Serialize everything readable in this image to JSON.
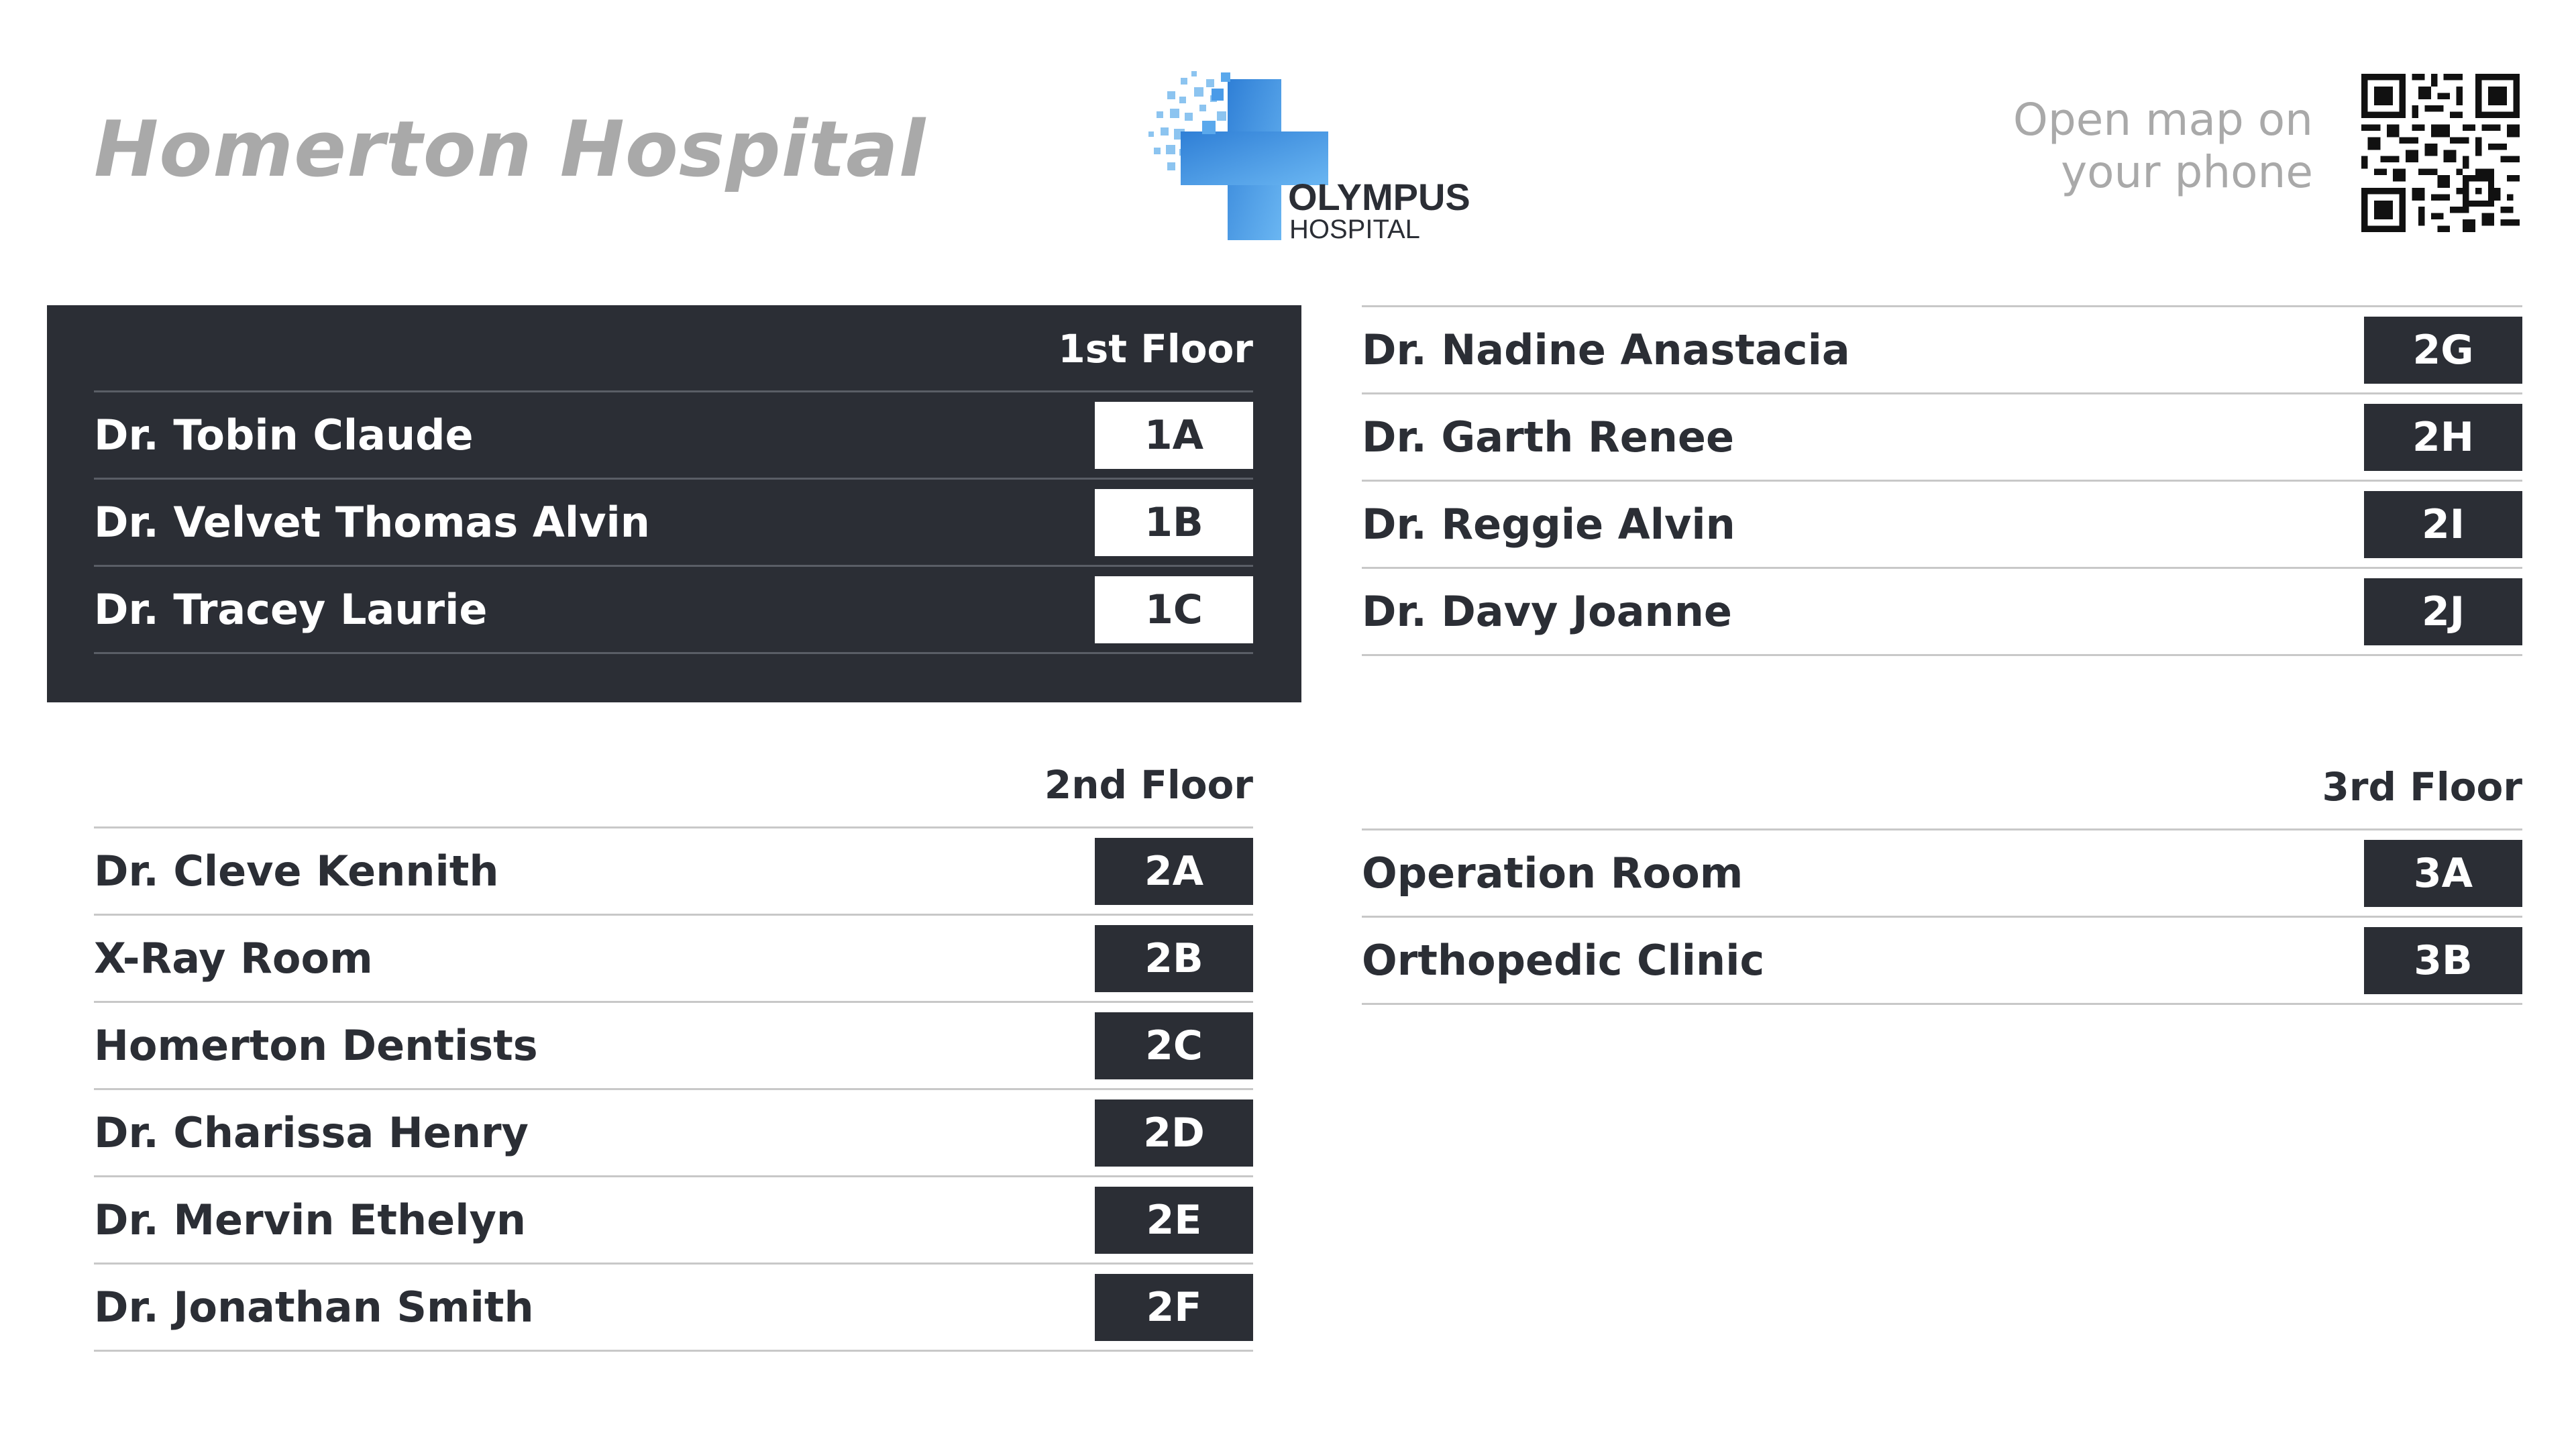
{
  "header": {
    "title": "Homerton Hospital",
    "logo": {
      "name": "OLYMPUS",
      "subtitle": "HOSPITAL"
    },
    "qr_prompt": "Open map on\nyour phone"
  },
  "colors": {
    "dark": "#2b2e35",
    "title_gray": "#a9a9a9",
    "logo_blue": "#4a9be8"
  },
  "floor1": {
    "header": "1st Floor",
    "rows": [
      {
        "name": "Dr. Tobin Claude",
        "room": "1A"
      },
      {
        "name": "Dr. Velvet Thomas Alvin",
        "room": "1B"
      },
      {
        "name": "Dr. Tracey Laurie",
        "room": "1C"
      }
    ]
  },
  "floor2_continued": {
    "rows": [
      {
        "name": "Dr. Nadine Anastacia",
        "room": "2G"
      },
      {
        "name": "Dr. Garth Renee",
        "room": "2H"
      },
      {
        "name": "Dr. Reggie Alvin",
        "room": "2I"
      },
      {
        "name": "Dr. Davy Joanne",
        "room": "2J"
      }
    ]
  },
  "floor2": {
    "header": "2nd Floor",
    "rows": [
      {
        "name": "Dr. Cleve Kennith",
        "room": "2A"
      },
      {
        "name": "X-Ray Room",
        "room": "2B"
      },
      {
        "name": "Homerton Dentists",
        "room": "2C"
      },
      {
        "name": "Dr. Charissa Henry",
        "room": "2D"
      },
      {
        "name": "Dr. Mervin Ethelyn",
        "room": "2E"
      },
      {
        "name": "Dr. Jonathan Smith",
        "room": "2F"
      }
    ]
  },
  "floor3": {
    "header": "3rd Floor",
    "rows": [
      {
        "name": "Operation Room",
        "room": "3A"
      },
      {
        "name": "Orthopedic Clinic",
        "room": "3B"
      }
    ]
  }
}
